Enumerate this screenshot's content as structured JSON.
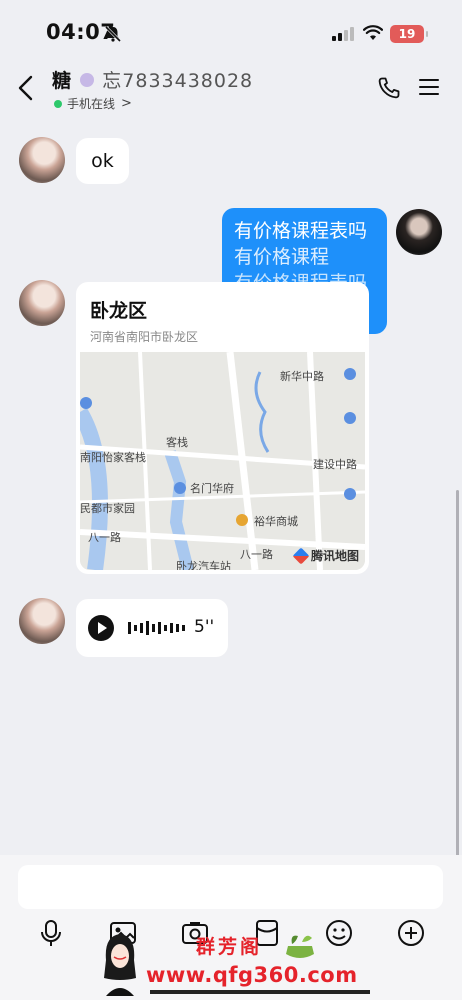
{
  "status": {
    "time": "04:07",
    "battery": "19"
  },
  "header": {
    "title_prefix": "糖",
    "title_rest": "忘7833438028",
    "presence": "手机在线",
    "presence_chevron": ">"
  },
  "messages": {
    "ok_text": "ok",
    "blue_line1": "有价格课程表吗",
    "blue_line2": "有价格课程",
    "blue_line3": "有价格课程表吗",
    "location": {
      "title": "卧龙区",
      "address": "河南省南阳市卧龙区",
      "map_labels": {
        "road_north": "新华中路",
        "road_east": "建设中路",
        "road_south1": "八一路",
        "road_south2": "八一路",
        "hotel": "南阳怡家客栈",
        "inn": "客栈",
        "garden": "民都市家园",
        "hostel": "名门华府",
        "mall": "裕华商城",
        "station": "卧龙汽车站"
      },
      "brand": "腾讯地图"
    },
    "voice_duration": "5''"
  },
  "input": {
    "placeholder": ""
  },
  "watermark": {
    "brand": "群芳阁",
    "site": "www.qfg360.com"
  },
  "colors": {
    "accent": "#1e90fa",
    "online": "#2dc86b",
    "battery": "#e25b59",
    "watermark": "#e5232b"
  }
}
